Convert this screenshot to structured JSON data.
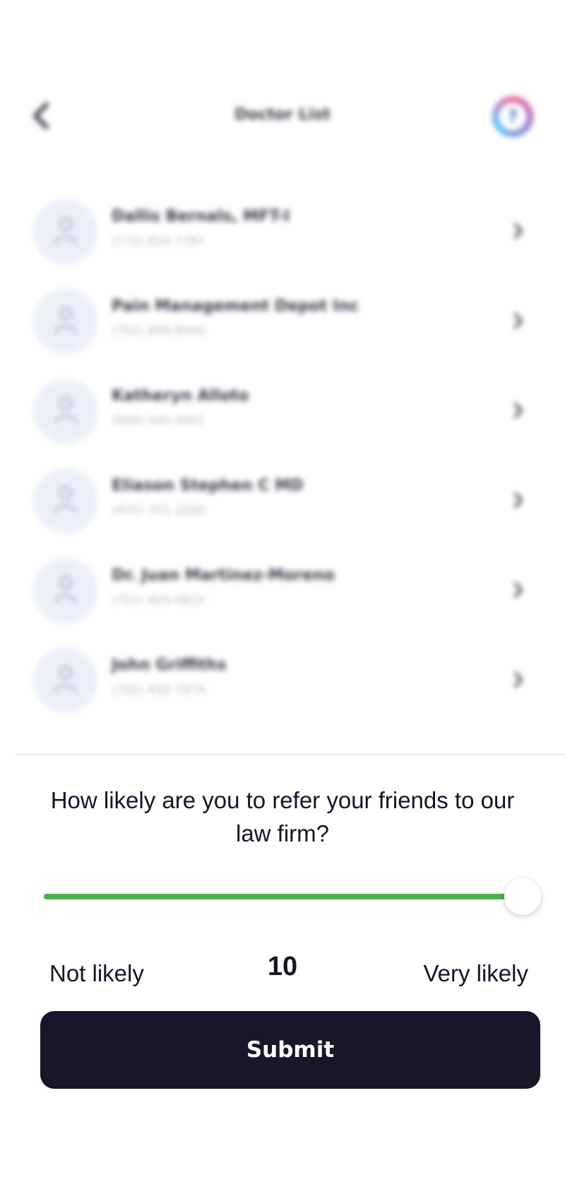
{
  "header": {
    "title": "Doctor List",
    "back_icon": "chevron-left-icon",
    "help_icon": "help-icon",
    "help_glyph": "?"
  },
  "doctors": [
    {
      "name": "Dallis Bernals, MFT-I",
      "phone": "(775) 826-7787"
    },
    {
      "name": "Pain Management Depot Inc",
      "phone": "(702) 808-8000"
    },
    {
      "name": "Katheryn Alloto",
      "phone": "(888) 440-4801"
    },
    {
      "name": "Eliason Stephen C MD",
      "phone": "(435) 351-1000"
    },
    {
      "name": "Dr. Juan Martinez-Moreno",
      "phone": "(702) 826-0815"
    },
    {
      "name": "John Griffiths",
      "phone": "(702) 830-7979"
    }
  ],
  "survey": {
    "question": "How likely are you to refer your friends to our law firm?",
    "min_label": "Not likely",
    "max_label": "Very likely",
    "value": "10",
    "slider_min": 0,
    "slider_max": 10,
    "slider_value": 10,
    "submit_label": "Submit"
  },
  "colors": {
    "slider_fill": "#4caf50",
    "button_bg": "#181629",
    "avatar_bg": "#eceff8"
  }
}
